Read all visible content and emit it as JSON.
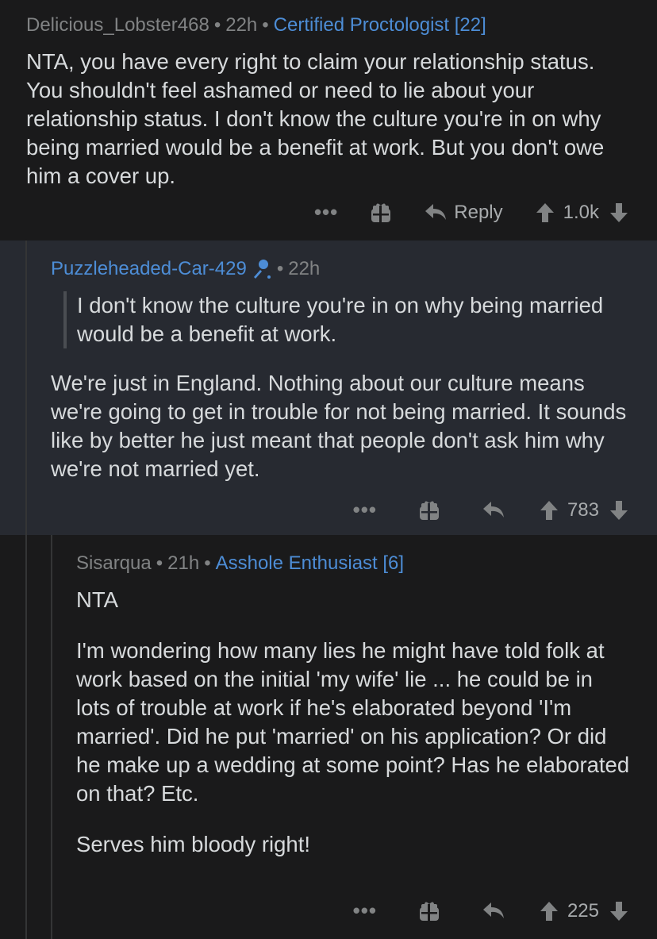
{
  "comments": [
    {
      "author": "Delicious_Lobster468",
      "time": "22h",
      "flair": "Certified Proctologist [22]",
      "body": "NTA, you have every right to claim your relationship status. You shouldn't feel ashamed or need to lie about your relationship status. I don't know the culture you're in on why being married would be a benefit at work. But you don't owe him a cover up.",
      "reply_label": "Reply",
      "score": "1.0k"
    },
    {
      "author": "Puzzleheaded-Car-429",
      "author_icon": "microphone-icon",
      "time": "22h",
      "quote": "I don't know the culture you're in on why being married would be a benefit at work.",
      "body": "We're just in England. Nothing about our culture means we're going to get in trouble for not being married. It sounds like by better he just meant that people don't ask him why we're not married yet.",
      "score": "783"
    },
    {
      "author": "Sisarqua",
      "time": "21h",
      "flair": "Asshole Enthusiast [6]",
      "paragraphs": [
        "NTA",
        "I'm wondering how many lies he might have told folk at work based on the initial 'my wife' lie ... he could be in lots of trouble at work if he's elaborated beyond 'I'm married'. Did he put 'married' on his application? Or did he make up a wedding at some point? Has he elaborated on that? Etc.",
        "Serves him bloody right!"
      ],
      "score": "225"
    }
  ],
  "colors": {
    "background": "#1a1a1b",
    "op_reply_background": "#272a31",
    "flair_blue": "#4d8dd6",
    "meta_gray": "#818384",
    "text": "#d7dadc"
  },
  "ellipsis": "•••"
}
